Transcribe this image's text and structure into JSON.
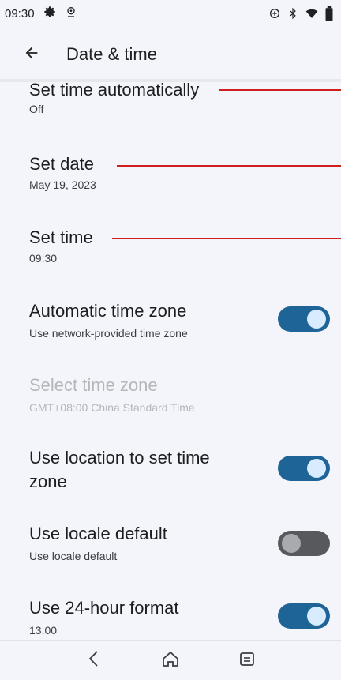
{
  "status_bar": {
    "time": "09:30",
    "left_icons": [
      "gear-icon",
      "location-icon"
    ],
    "right_icons": [
      "data-saver-icon",
      "bluetooth-icon",
      "wifi-icon",
      "battery-icon"
    ]
  },
  "app_bar": {
    "title": "Date & time",
    "back_icon": "arrow-back-icon"
  },
  "settings": {
    "set_time_auto": {
      "title": "Set time automatically",
      "subtitle": "Off"
    },
    "set_date": {
      "title": "Set date",
      "subtitle": "May 19, 2023"
    },
    "set_time": {
      "title": "Set time",
      "subtitle": "09:30"
    },
    "auto_timezone": {
      "title": "Automatic time zone",
      "subtitle": "Use network-provided time zone",
      "enabled": true
    },
    "select_timezone": {
      "title": "Select time zone",
      "subtitle": "GMT+08:00 China Standard Time",
      "disabled": true
    },
    "location_timezone": {
      "title_line1": "Use location to set time",
      "title_line2": "zone",
      "enabled": true
    },
    "locale_default": {
      "title": "Use locale default",
      "subtitle": "Use locale default",
      "enabled": false
    },
    "hour24": {
      "title": "Use 24-hour format",
      "subtitle": "13:00",
      "enabled": true
    }
  },
  "colors": {
    "background": "#f3f5fb",
    "toggle_on_track": "#1e6496",
    "toggle_on_knob": "#d9ecff",
    "toggle_off_track": "#58595c",
    "annotation_line": "#d21d1d"
  },
  "nav_bar": {
    "buttons": [
      "back-nav-icon",
      "home-nav-icon",
      "recents-nav-icon"
    ]
  }
}
